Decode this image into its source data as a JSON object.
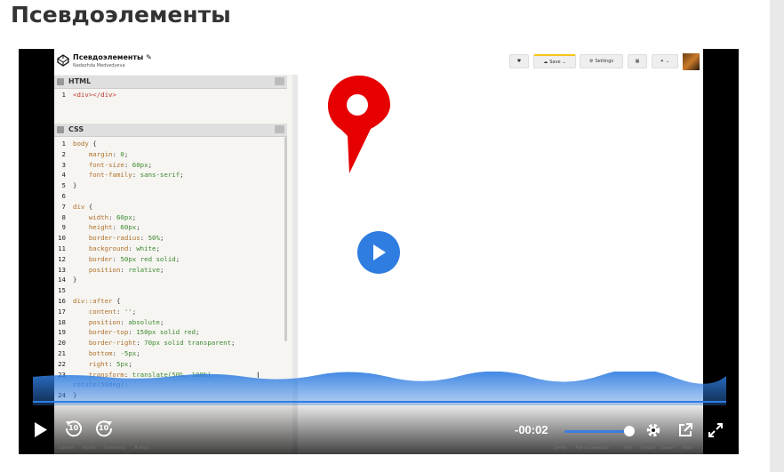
{
  "page": {
    "heading": "Псевдоэлементы"
  },
  "codepen": {
    "title": "Псевдоэлементы",
    "author": "Nadezhda Medvedyeva",
    "buttons": {
      "save": "Save",
      "settings": "Settings"
    }
  },
  "editor": {
    "html_label": "HTML",
    "css_label": "CSS",
    "html_lines": [
      {
        "n": "1",
        "code": "<div></div>"
      }
    ],
    "css_lines": [
      {
        "n": "1",
        "code": "body {"
      },
      {
        "n": "2",
        "code": "    margin: 0;"
      },
      {
        "n": "3",
        "code": "    font-size: 60px;"
      },
      {
        "n": "4",
        "code": "    font-family: sans-serif;"
      },
      {
        "n": "5",
        "code": "}"
      },
      {
        "n": "6",
        "code": ""
      },
      {
        "n": "7",
        "code": "div {"
      },
      {
        "n": "8",
        "code": "    width: 60px;"
      },
      {
        "n": "9",
        "code": "    height: 60px;"
      },
      {
        "n": "10",
        "code": "    border-radius: 50%;"
      },
      {
        "n": "11",
        "code": "    background: white;"
      },
      {
        "n": "12",
        "code": "    border: 50px red solid;"
      },
      {
        "n": "13",
        "code": "    position: relative;"
      },
      {
        "n": "14",
        "code": "}"
      },
      {
        "n": "15",
        "code": ""
      },
      {
        "n": "16",
        "code": "div::after {"
      },
      {
        "n": "17",
        "code": "    content: '';"
      },
      {
        "n": "18",
        "code": "    position: absolute;"
      },
      {
        "n": "19",
        "code": "    border-top: 150px solid red;"
      },
      {
        "n": "20",
        "code": "    border-right: 70px solid transparent;"
      },
      {
        "n": "21",
        "code": "    bottom: -5px;"
      },
      {
        "n": "22",
        "code": "    right: 5px;"
      },
      {
        "n": "23",
        "code": "    transform: translate(50%, 100%)"
      },
      {
        "n": "",
        "code": "rotate(50deg);"
      },
      {
        "n": "24",
        "code": "}"
      }
    ]
  },
  "player": {
    "time_remaining": "-00:02",
    "volume": 0.9,
    "skip_back_seconds": "10",
    "skip_forward_seconds": "10"
  },
  "bottom_bar": {
    "left": [
      "Console",
      "Assets",
      "Comments",
      "⌘ Keys"
    ],
    "right": [
      "Delete",
      "Add to Collection",
      "Fork",
      "Embed",
      "Export",
      "Share"
    ]
  },
  "colors": {
    "accent": "#2f7de1",
    "pin": "#e60000",
    "wave": "#2f7de1"
  }
}
